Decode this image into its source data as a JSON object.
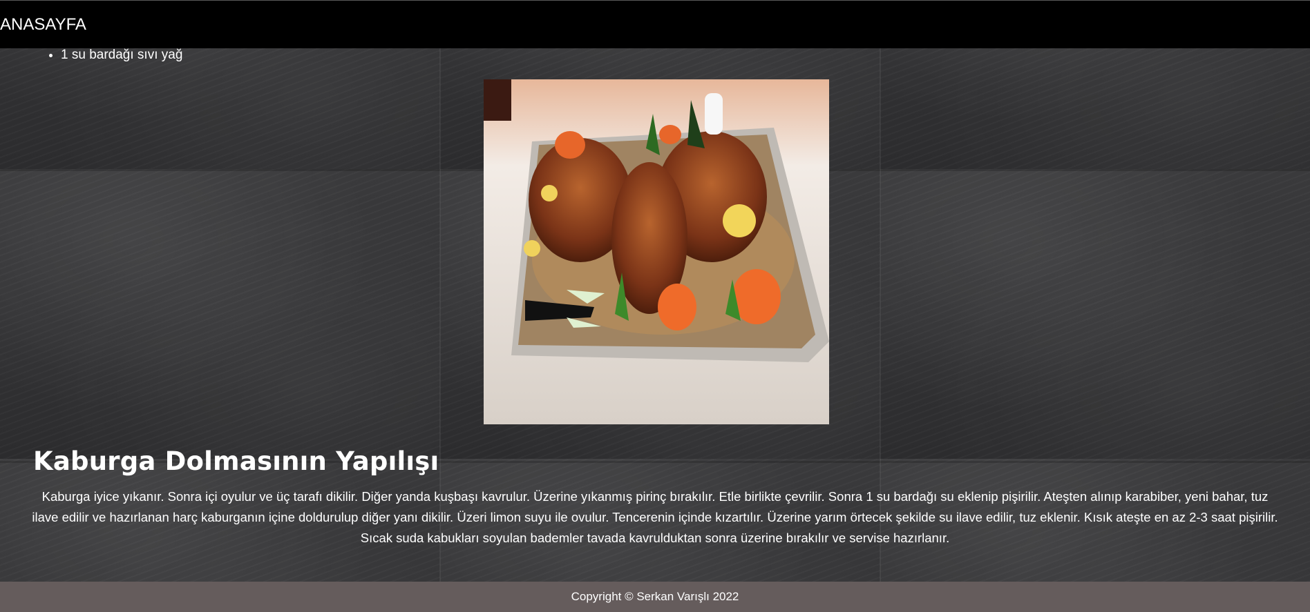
{
  "nav": {
    "home_label": "ANASAYFA"
  },
  "ingredients": [
    "1 su bardağı sıvı yağ"
  ],
  "dish_image": {
    "icon": "stuffed-ribs-photo"
  },
  "recipe": {
    "title": "Kaburga Dolmasının Yapılışı",
    "text": "Kaburga iyice yıkanır. Sonra içi oyulur ve üç tarafı dikilir. Diğer yanda kuşbaşı kavrulur. Üzerine yıkanmış pirinç bırakılır. Etle birlikte çevrilir. Sonra 1 su bardağı su eklenip pişirilir. Ateşten alınıp karabiber, yeni bahar, tuz ilave edilir ve hazırlanan harç kaburganın içine doldurulup diğer yanı dikilir. Üzeri limon suyu ile ovulur. Tencerenin içinde kızartılır. Üzerine yarım örtecek şekilde su ilave edilir, tuz eklenir. Kısık ateşte en az 2-3 saat pişirilir. Sıcak suda kabukları soyulan bademler tavada kavrulduktan sonra üzerine bırakılır ve servise hazırlanır."
  },
  "footer": {
    "copyright": "Copyright © Serkan Varışlı 2022"
  },
  "colors": {
    "navbar": "#000000",
    "footer": "#655c5c",
    "text": "#ffffff",
    "board": "#2e2e30"
  }
}
